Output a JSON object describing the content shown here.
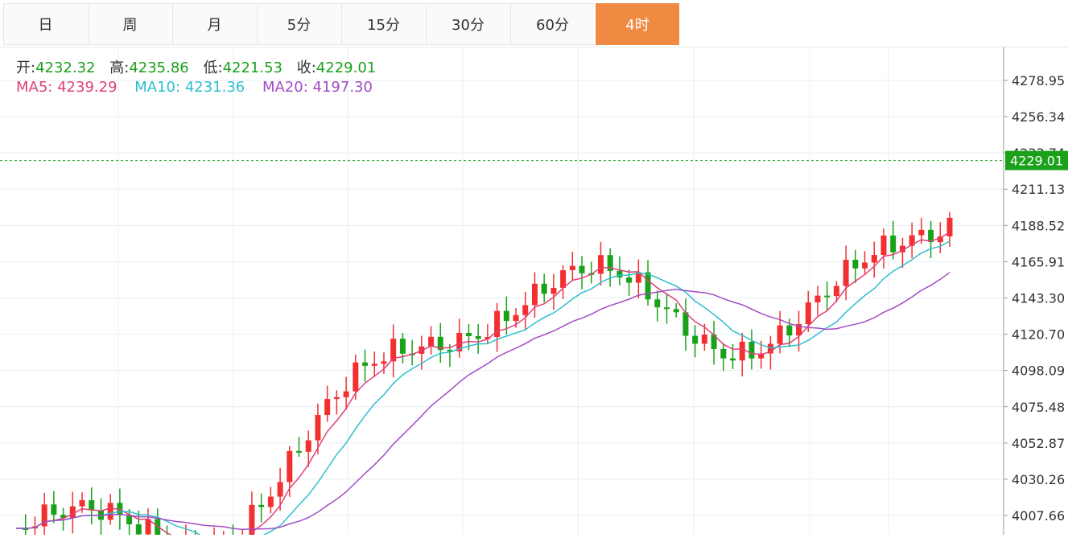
{
  "tabs": [
    {
      "label": "日",
      "active": false
    },
    {
      "label": "周",
      "active": false
    },
    {
      "label": "月",
      "active": false
    },
    {
      "label": "5分",
      "active": false
    },
    {
      "label": "15分",
      "active": false
    },
    {
      "label": "30分",
      "active": false
    },
    {
      "label": "60分",
      "active": false
    },
    {
      "label": "4时",
      "active": true
    }
  ],
  "colors": {
    "up": "#f23030",
    "down": "#1aa11a",
    "ma5": "#e0407a",
    "ma10": "#2dbfcf",
    "ma20": "#a24cc4",
    "active_tab": "#f08a43"
  },
  "chart_data": {
    "type": "candlestick",
    "title": "",
    "ohlc_labels": {
      "open": "开:",
      "open_value": "4232.32",
      "high": "高:",
      "high_value": "4235.86",
      "low": "低:",
      "low_value": "4221.53",
      "close": "收:",
      "close_value": "4229.01"
    },
    "ma_labels": {
      "ma5": "MA5: ",
      "ma5_value": "4239.29",
      "ma10": "MA10: ",
      "ma10_value": "4231.36",
      "ma20": "MA20: ",
      "ma20_value": "4197.30"
    },
    "y_ticks": [
      "4278.95",
      "4256.34",
      "4233.74",
      "4211.13",
      "4188.52",
      "4165.91",
      "4143.30",
      "4120.70",
      "4098.09",
      "4075.48",
      "4052.87",
      "4030.26",
      "4007.66"
    ],
    "current_price": "4229.01"
  }
}
